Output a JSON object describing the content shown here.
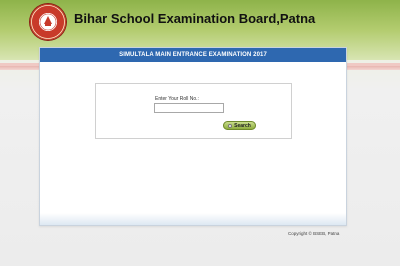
{
  "header": {
    "title": "Bihar School Examination Board,Patna",
    "logo_icon": "bseb-emblem-icon"
  },
  "panel": {
    "title": "SIMULTALA MAIN ENTRANCE EXAMINATION 2017"
  },
  "form": {
    "roll_label": "Enter Your Roll No.:",
    "roll_value": "",
    "search_label": "Search"
  },
  "footer": {
    "copyright": "Copyright © BSEB, Patna"
  },
  "colors": {
    "header_green": "#8eb34a",
    "panel_header_blue": "#2e68b0",
    "button_green": "#8fae3e"
  }
}
